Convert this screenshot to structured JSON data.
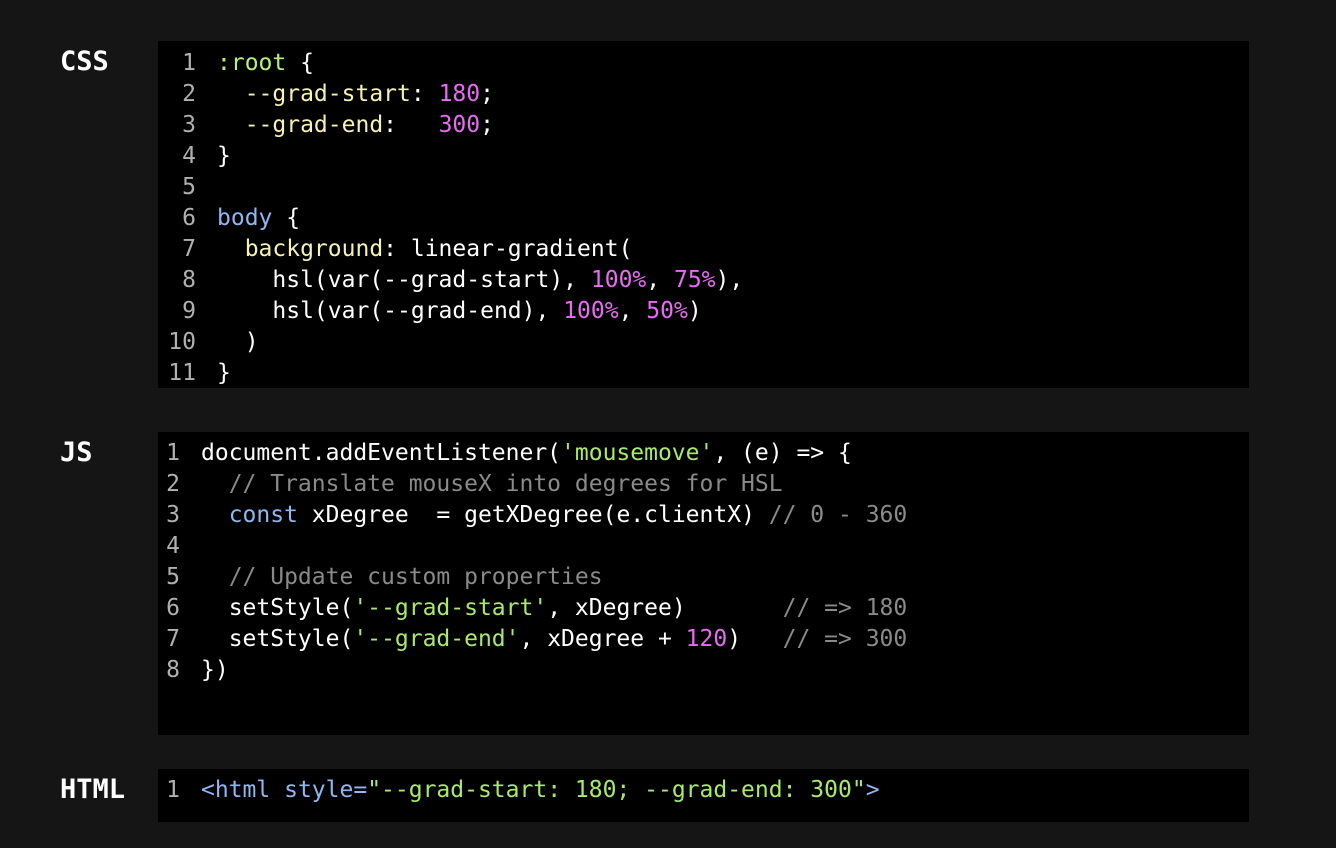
{
  "labels": {
    "css": "CSS",
    "js": "JS",
    "html": "HTML"
  },
  "css_lines": [
    {
      "n": "1",
      "tokens": [
        {
          "t": ":root",
          "c": "sel"
        },
        {
          "t": " {",
          "c": ""
        }
      ]
    },
    {
      "n": "2",
      "tokens": [
        {
          "t": "  --grad-start",
          "c": "prop"
        },
        {
          "t": ": ",
          "c": ""
        },
        {
          "t": "180",
          "c": "num"
        },
        {
          "t": ";",
          "c": ""
        }
      ]
    },
    {
      "n": "3",
      "tokens": [
        {
          "t": "  --grad-end",
          "c": "prop"
        },
        {
          "t": ":   ",
          "c": ""
        },
        {
          "t": "300",
          "c": "num"
        },
        {
          "t": ";",
          "c": ""
        }
      ]
    },
    {
      "n": "4",
      "tokens": [
        {
          "t": "}",
          "c": ""
        }
      ]
    },
    {
      "n": "5",
      "tokens": []
    },
    {
      "n": "6",
      "tokens": [
        {
          "t": "body",
          "c": "tag"
        },
        {
          "t": " {",
          "c": ""
        }
      ]
    },
    {
      "n": "7",
      "tokens": [
        {
          "t": "  background",
          "c": "prop"
        },
        {
          "t": ": linear-gradient(",
          "c": ""
        }
      ]
    },
    {
      "n": "8",
      "tokens": [
        {
          "t": "    hsl(var(--grad-start), ",
          "c": ""
        },
        {
          "t": "100%",
          "c": "num"
        },
        {
          "t": ", ",
          "c": ""
        },
        {
          "t": "75%",
          "c": "num"
        },
        {
          "t": "),",
          "c": ""
        }
      ]
    },
    {
      "n": "9",
      "tokens": [
        {
          "t": "    hsl(var(--grad-end), ",
          "c": ""
        },
        {
          "t": "100%",
          "c": "num"
        },
        {
          "t": ", ",
          "c": ""
        },
        {
          "t": "50%",
          "c": "num"
        },
        {
          "t": ")",
          "c": ""
        }
      ]
    },
    {
      "n": "10",
      "tokens": [
        {
          "t": "  )",
          "c": ""
        }
      ]
    },
    {
      "n": "11",
      "tokens": [
        {
          "t": "}",
          "c": ""
        }
      ]
    }
  ],
  "js_lines": [
    {
      "n": "1",
      "tokens": [
        {
          "t": "document.addEventListener(",
          "c": ""
        },
        {
          "t": "'mousemove'",
          "c": "str"
        },
        {
          "t": ", (e) => {",
          "c": ""
        }
      ]
    },
    {
      "n": "2",
      "tokens": [
        {
          "t": "  // Translate mouseX into degrees for HSL",
          "c": "cmt"
        }
      ]
    },
    {
      "n": "3",
      "tokens": [
        {
          "t": "  ",
          "c": ""
        },
        {
          "t": "const",
          "c": "kw"
        },
        {
          "t": " xDegree  = getXDegree(e.clientX) ",
          "c": ""
        },
        {
          "t": "// 0 - 360",
          "c": "cmt"
        }
      ]
    },
    {
      "n": "4",
      "tokens": []
    },
    {
      "n": "5",
      "tokens": [
        {
          "t": "  // Update custom properties",
          "c": "cmt"
        }
      ]
    },
    {
      "n": "6",
      "tokens": [
        {
          "t": "  setStyle(",
          "c": ""
        },
        {
          "t": "'--grad-start'",
          "c": "str"
        },
        {
          "t": ", xDegree)       ",
          "c": ""
        },
        {
          "t": "// => 180",
          "c": "cmt"
        }
      ]
    },
    {
      "n": "7",
      "tokens": [
        {
          "t": "  setStyle(",
          "c": ""
        },
        {
          "t": "'--grad-end'",
          "c": "str"
        },
        {
          "t": ", xDegree + ",
          "c": ""
        },
        {
          "t": "120",
          "c": "num"
        },
        {
          "t": ")   ",
          "c": ""
        },
        {
          "t": "// => 300",
          "c": "cmt"
        }
      ]
    },
    {
      "n": "8",
      "tokens": [
        {
          "t": "})",
          "c": ""
        }
      ]
    }
  ],
  "html_lines": [
    {
      "n": "1",
      "tokens": [
        {
          "t": "<html",
          "c": "tag"
        },
        {
          "t": " style=",
          "c": "tag"
        },
        {
          "t": "\"--grad-start: 180; --grad-end: 300\"",
          "c": "attr"
        },
        {
          "t": ">",
          "c": "tag"
        }
      ]
    }
  ],
  "colors": {
    "page_bg": "#151515",
    "code_bg": "#000000",
    "selector": "#b8f272",
    "property": "#f6f2b5",
    "number": "#e76cf2",
    "string": "#a8ea6c",
    "comment": "#8a8a8a",
    "keyword": "#8fb8f2"
  }
}
